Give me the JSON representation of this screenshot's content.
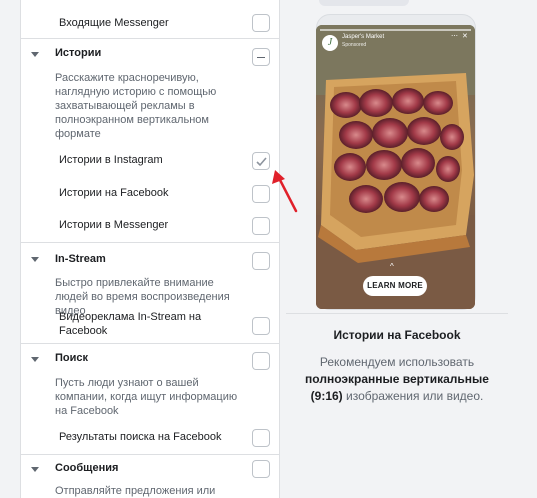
{
  "placements": {
    "messenger_inbox": {
      "label": "Входящие Messenger",
      "checked": false
    },
    "stories": {
      "title": "Истории",
      "description": "Расскажите красноречивую, наглядную историю с помощью захватывающей рекламы в полноэкранном вертикальном формате",
      "state": "mixed",
      "items": [
        {
          "label": "Истории в Instagram",
          "checked": true
        },
        {
          "label": "Истории на Facebook",
          "checked": false
        },
        {
          "label": "Истории в Messenger",
          "checked": false
        }
      ]
    },
    "instream": {
      "title": "In-Stream",
      "description": "Быстро привлекайте внимание людей во время воспроизведения видео",
      "items": [
        {
          "label": "Видеореклама In-Stream на Facebook",
          "checked": false
        }
      ]
    },
    "search": {
      "title": "Поиск",
      "description": "Пусть люди узнают о вашей компании, когда ищут информацию на Facebook",
      "items": [
        {
          "label": "Результаты поиска на Facebook",
          "checked": false
        }
      ]
    },
    "messages": {
      "title": "Сообщения",
      "description": "Отправляйте предложения или"
    }
  },
  "preview": {
    "brand_name": "Jasper's Market",
    "brand_sub": "Sponsored",
    "brand_initial": "J",
    "cta_label": "LEARN MORE",
    "title": "Истории на Facebook",
    "desc_part1": "Рекомендуем использовать ",
    "desc_bold": "полноэкранные вертикальные (9:16)",
    "desc_part2": " изображения или видео."
  },
  "colors": {
    "annotation_arrow": "#e0202a",
    "checkbox_border": "#bec3c9"
  }
}
